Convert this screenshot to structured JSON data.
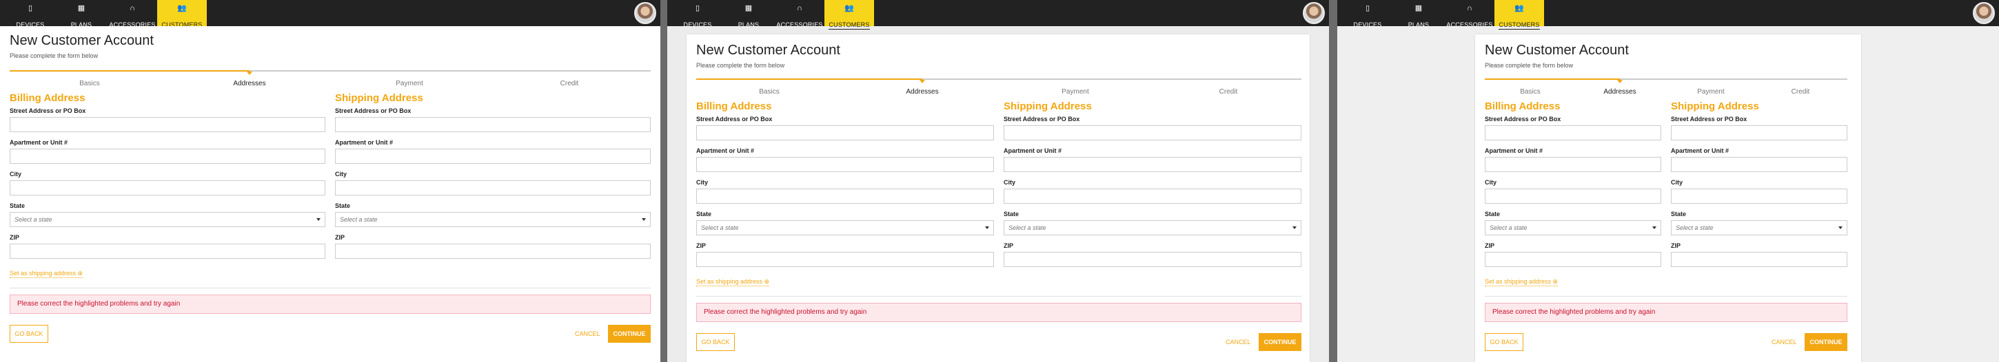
{
  "nav": {
    "items": [
      {
        "label": "DEVICES",
        "icon": "mobile-icon",
        "glyph": "▯"
      },
      {
        "label": "PLANS",
        "icon": "calendar-icon",
        "glyph": "▦"
      },
      {
        "label": "ACCESSORIES",
        "icon": "headphones-icon",
        "glyph": "∩"
      },
      {
        "label": "CUSTOMERS",
        "icon": "users-icon",
        "glyph": "👥"
      }
    ],
    "active": "CUSTOMERS",
    "active_color": "#f7d51a",
    "bar_color": "#222222"
  },
  "form": {
    "title": "New Customer Account",
    "subtitle": "Please complete the form below",
    "steps": [
      "Basics",
      "Addresses",
      "Payment",
      "Credit"
    ],
    "current_step": "Addresses",
    "billing": {
      "heading": "Billing Address",
      "street_label": "Street Address or PO Box",
      "unit_label": "Apartment or Unit #",
      "city_label": "City",
      "state_label": "State",
      "state_placeholder": "Select a state",
      "zip_label": "ZIP"
    },
    "shipping": {
      "heading": "Shipping Address",
      "street_label": "Street Address or PO Box",
      "unit_label": "Apartment or Unit #",
      "city_label": "City",
      "state_label": "State",
      "state_placeholder": "Select a state",
      "zip_label": "ZIP"
    },
    "set_shipping_link": "Set as shipping address ⊕",
    "error_message": "Please correct the highlighted problems and try again",
    "go_back": "GO BACK",
    "cancel": "CANCEL",
    "continue": "CONTINUE",
    "accent_color": "#f3a712",
    "error_color": "#c8102e"
  }
}
